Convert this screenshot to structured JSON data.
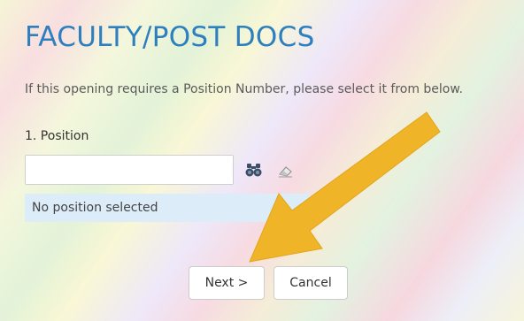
{
  "page": {
    "title": "FACULTY/POST DOCS",
    "instruction": "If this opening requires a Position Number, please select it from below.",
    "field_label": "1. Position"
  },
  "position_field": {
    "value": "",
    "placeholder": "",
    "search_icon": "binoculars-icon",
    "clear_icon": "eraser-icon"
  },
  "selection_status": "No position selected",
  "buttons": {
    "next": "Next >",
    "cancel": "Cancel"
  },
  "annotation": {
    "arrow_icon": "arrow-icon",
    "arrow_color": "#f0b429"
  },
  "colors": {
    "title": "#2d7fbe",
    "status_bg": "#dcecf8"
  }
}
